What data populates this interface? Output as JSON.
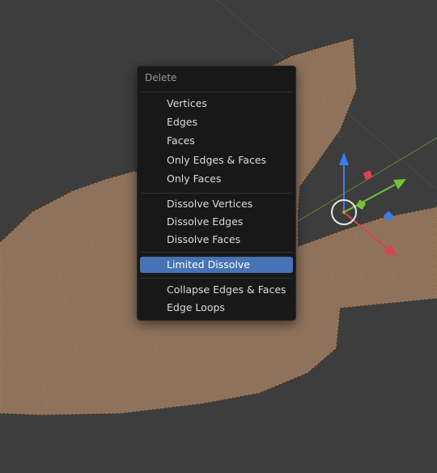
{
  "colors": {
    "background": "#3c3c3c",
    "mesh_fill": "#8e725c",
    "mesh_edge": "#f08a2c",
    "menu_bg": "#181818",
    "highlight": "#4772b3",
    "axis_z": "#3a7ef0",
    "axis_y": "#74c33a",
    "axis_x": "#e0404e"
  },
  "viewport": {
    "gizmo_icons": [
      "move-gizmo-z-arrow-icon",
      "move-gizmo-y-arrow-icon",
      "move-gizmo-x-arrow-icon",
      "pivot-circle-icon"
    ]
  },
  "menu": {
    "title": "Delete",
    "groups": [
      {
        "items": [
          {
            "label": "Vertices",
            "active": false
          },
          {
            "label": "Edges",
            "active": false
          },
          {
            "label": "Faces",
            "active": false
          },
          {
            "label": "Only Edges & Faces",
            "active": false
          },
          {
            "label": "Only Faces",
            "active": false
          }
        ]
      },
      {
        "items": [
          {
            "label": "Dissolve Vertices",
            "active": false
          },
          {
            "label": "Dissolve Edges",
            "active": false
          },
          {
            "label": "Dissolve Faces",
            "active": false
          }
        ]
      },
      {
        "items": [
          {
            "label": "Limited Dissolve",
            "active": true
          }
        ]
      },
      {
        "items": [
          {
            "label": "Collapse Edges & Faces",
            "active": false
          },
          {
            "label": "Edge Loops",
            "active": false
          }
        ]
      }
    ]
  }
}
